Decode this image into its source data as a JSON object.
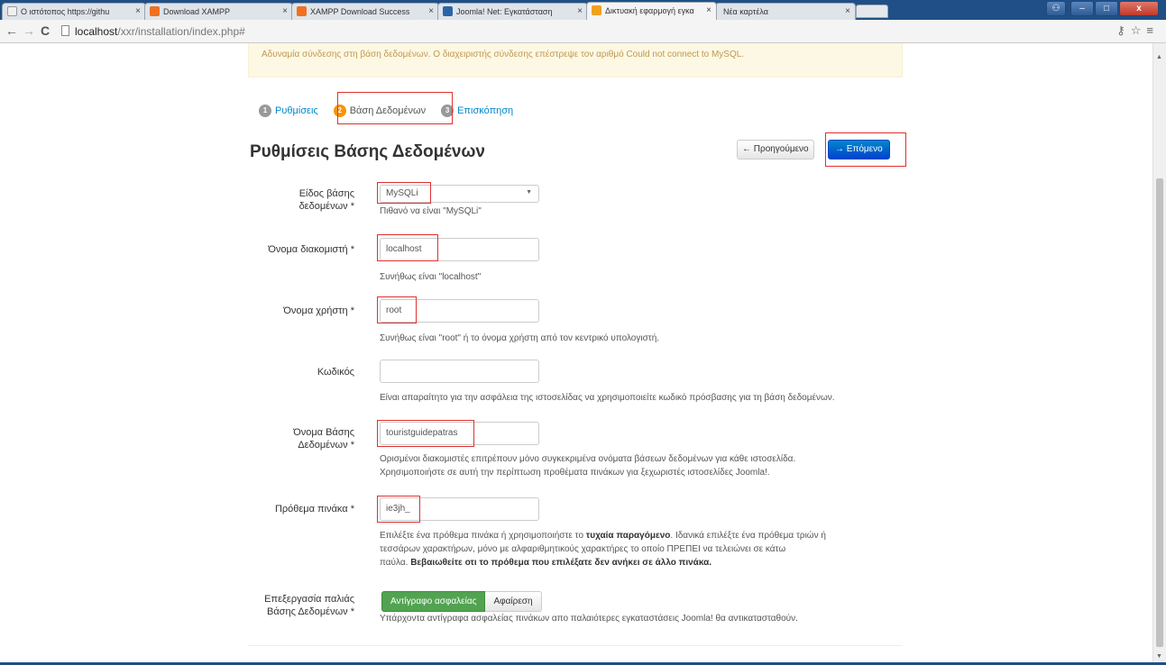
{
  "browser": {
    "tabs": [
      {
        "title": "Ο ιστότοπος https://githu",
        "fav_color": "#f0f0f0"
      },
      {
        "title": "Download XAMPP",
        "fav_color": "#f07020"
      },
      {
        "title": "XAMPP Download Success",
        "fav_color": "#f07020"
      },
      {
        "title": "Joomla! Net: Εγκατάσταση",
        "fav_color": "#2a64a8"
      },
      {
        "title": "Δικτυακή εφαρμογή εγκα",
        "fav_color": "#f0a020"
      },
      {
        "title": "Νέα καρτέλα",
        "fav_color": ""
      }
    ],
    "url_host": "localhost",
    "url_path": "/xxr/installation/index.php#"
  },
  "alert_text": "Αδυναμία σύνδεσης στη βάση δεδομένων. Ο διαχειριστής σύνδεσης επέστρεψε τον αριθμό Could not connect to MySQL.",
  "steps": [
    {
      "num": "1",
      "label": "Ρυθμίσεις"
    },
    {
      "num": "2",
      "label": "Βάση Δεδομένων"
    },
    {
      "num": "3",
      "label": "Επισκόπηση"
    }
  ],
  "heading": "Ρυθμίσεις Βάσης Δεδομένων",
  "buttons": {
    "prev": "← Προηγούμενο",
    "next": "→ Επόμενο"
  },
  "form": {
    "db_type": {
      "label_1": "Είδος βάσης",
      "label_2": "δεδομένων *",
      "value": "MySQLi",
      "help": "Πιθανό να είναι \"MySQLi\""
    },
    "host": {
      "label": "Όνομα διακομιστή *",
      "value": "localhost",
      "help": "Συνήθως είναι \"localhost\""
    },
    "user": {
      "label": "Όνομα χρήστη *",
      "value": "root",
      "help": "Συνήθως είναι \"root\" ή το όνομα χρήστη από τον κεντρικό υπολογιστή."
    },
    "password": {
      "label": "Κωδικός",
      "value": "",
      "help": "Είναι απαραίτητο για την ασφάλεια της ιστοσελίδας να χρησιμοποιείτε κωδικό πρόσβασης για τη βάση δεδομένων."
    },
    "db_name": {
      "label_1": "Όνομα Βάσης",
      "label_2": "Δεδομένων *",
      "value": "touristguidepatras",
      "help_1": "Ορισμένοι διακομιστές επιτρέπουν μόνο συγκεκριμένα ονόματα βάσεων δεδομένων για κάθε ιστοσελίδα.",
      "help_2": "Χρησιμοποιήστε σε αυτή την περίπτωση προθέματα πινάκων για ξεχωριστές ιστοσελίδες Joomla!."
    },
    "prefix": {
      "label": "Πρόθεμα πινάκα *",
      "value": "ie3jh_",
      "help_1a": "Επιλέξτε ένα πρόθεμα πινάκα ή χρησιμοποιήστε το ",
      "help_1b": "τυχαία παραγόμενο",
      "help_1c": ". Ιδανικά επιλέξτε ένα πρόθεμα τριών ή",
      "help_2": "τεσσάρων χαρακτήρων, μόνο με αλφαριθμητικούς χαρακτήρες το οποίο ΠΡΕΠΕΙ να τελειώνει σε κάτω",
      "help_3a": "παύλα.",
      "help_3b": "Βεβαιωθείτε οτι το πρόθεμα που επιλέξατε δεν ανήκει σε άλλο πινάκα."
    },
    "old_db": {
      "label_1": "Επεξεργασία παλιάς",
      "label_2": "Βάσης Δεδομένων *",
      "opt_backup": "Αντίγραφο ασφαλείας",
      "opt_remove": "Αφαίρεση",
      "help": "Υπάρχοντα αντίγραφα ασφαλείας πινάκων απο παλαιότερες εγκαταστάσεις Joomla! θα αντικατασταθούν."
    }
  }
}
